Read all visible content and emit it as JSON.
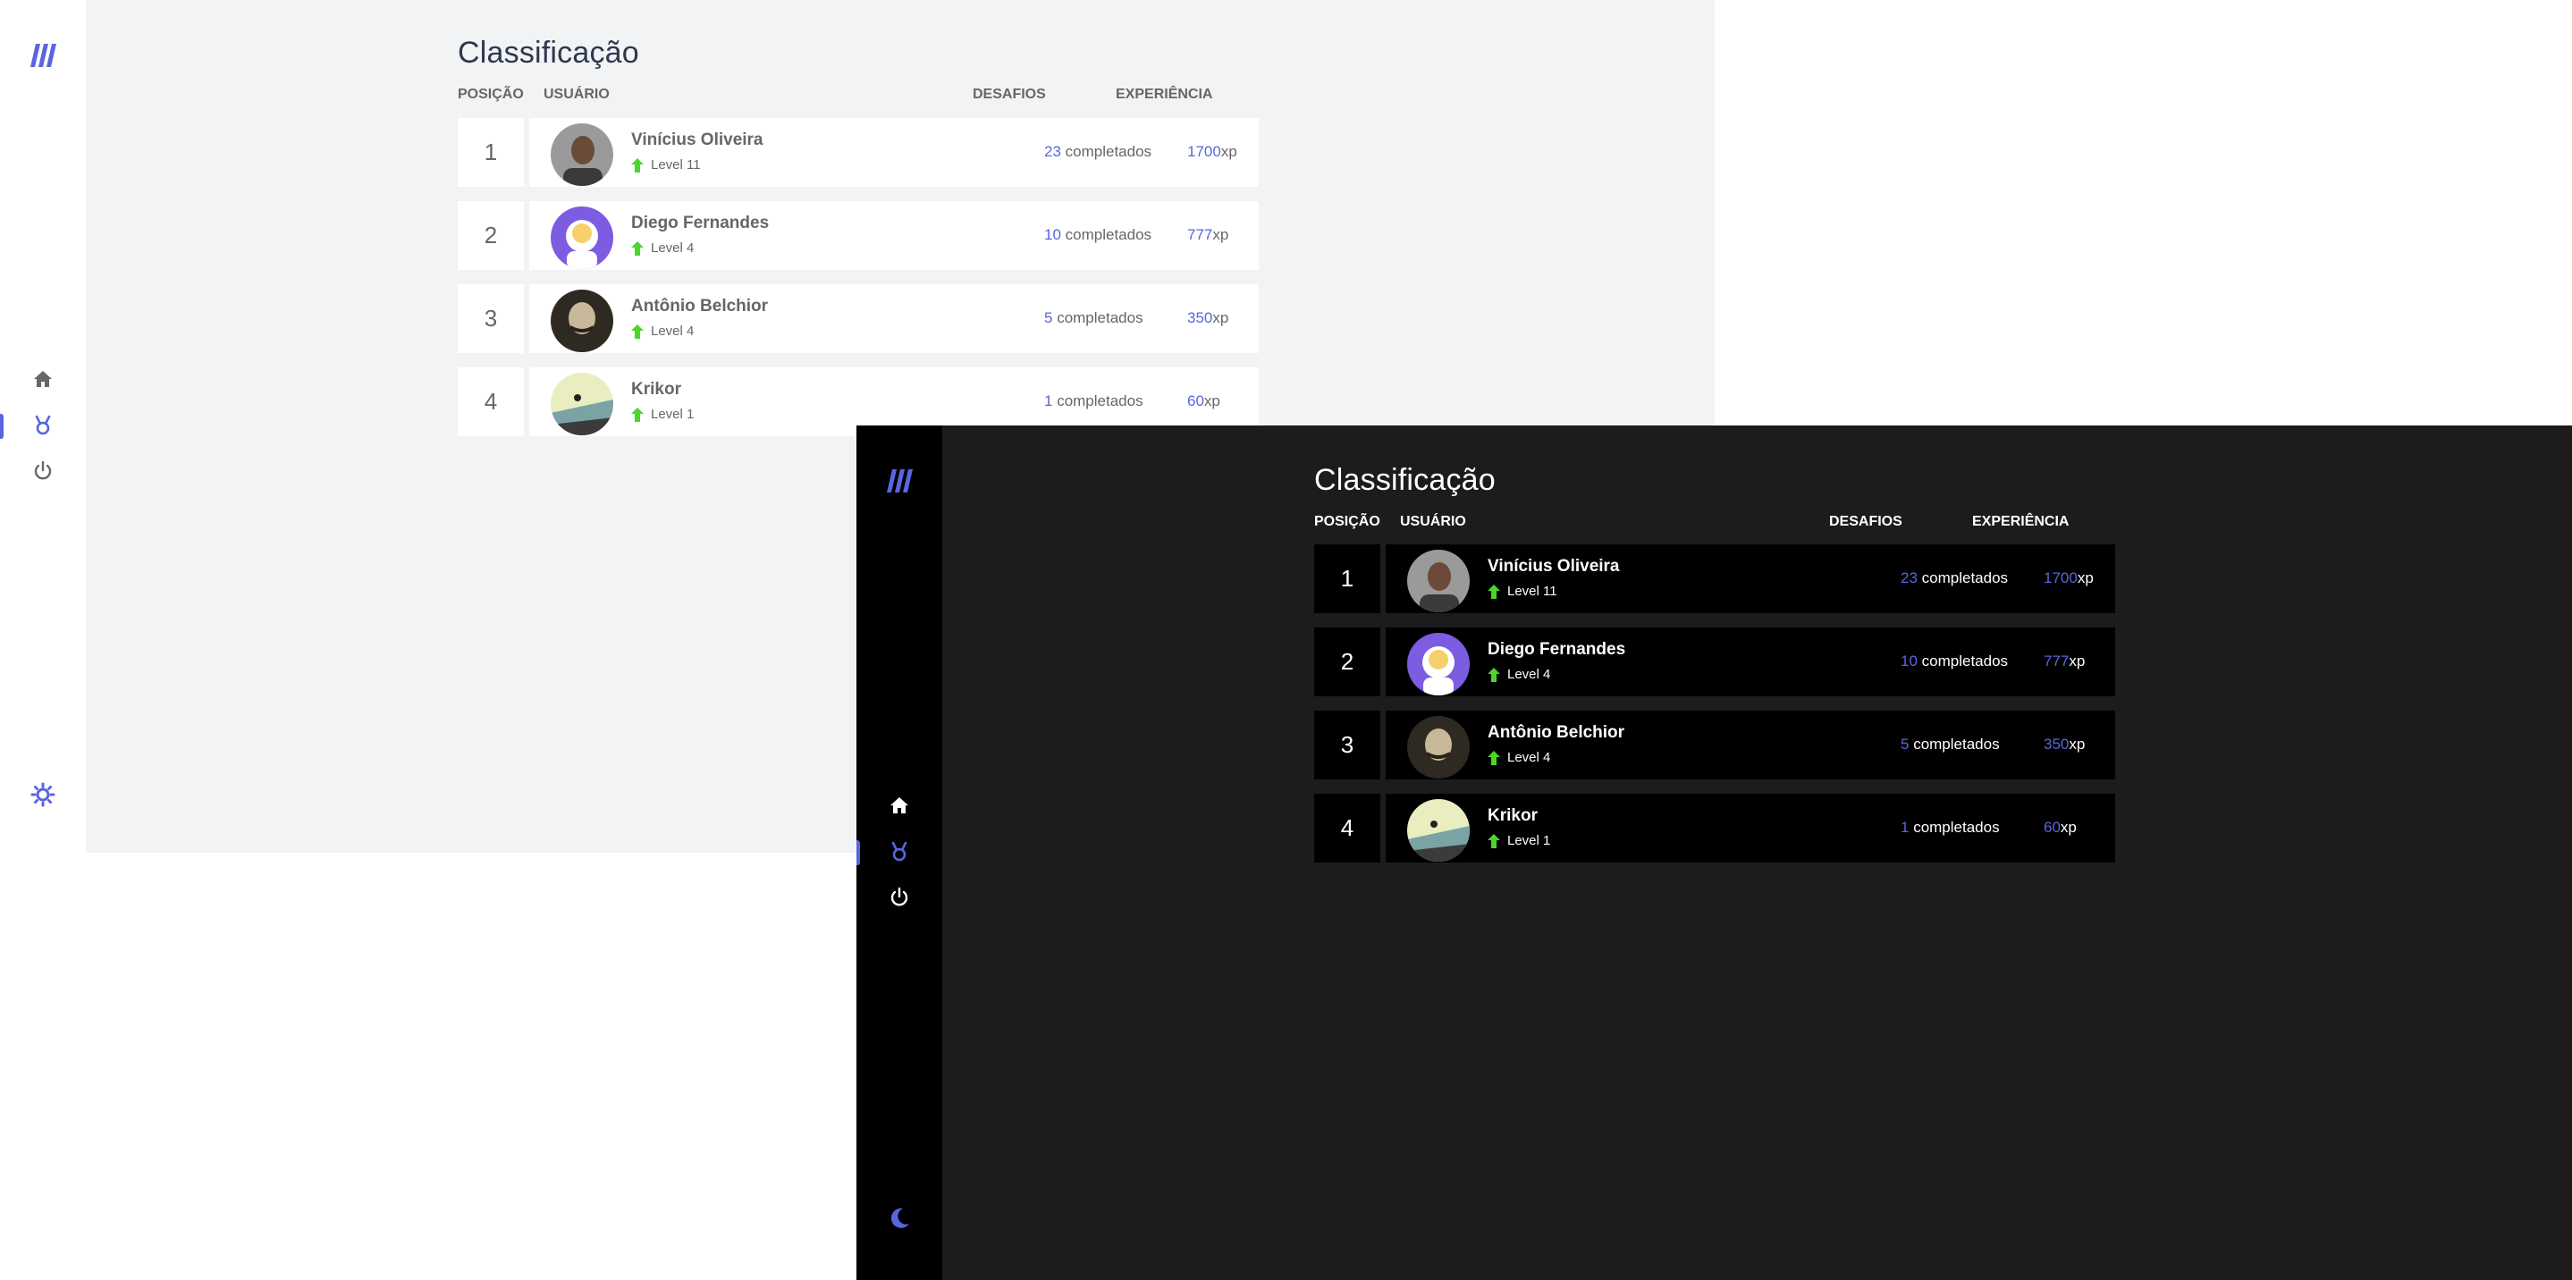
{
  "colors": {
    "accent": "#5965e0",
    "level_up": "#4cd62b"
  },
  "light": {
    "title": "Classificação",
    "columns": {
      "position": "Posição",
      "user": "Usuário",
      "challenges": "Desafios",
      "experience": "Experiência"
    },
    "nav": {
      "home": "home-icon",
      "leaderboard": "medal-icon",
      "logout": "power-icon",
      "theme": "sun-icon"
    },
    "rows": [
      {
        "position": "1",
        "name": "Vinícius Oliveira",
        "level": "Level 11",
        "challenges": "23",
        "challenges_suffix": " completados",
        "xp": "1700",
        "xp_suffix": "xp"
      },
      {
        "position": "2",
        "name": "Diego Fernandes",
        "level": "Level 4",
        "challenges": "10",
        "challenges_suffix": " completados",
        "xp": "777",
        "xp_suffix": "xp"
      },
      {
        "position": "3",
        "name": "Antônio Belchior",
        "level": "Level 4",
        "challenges": "5",
        "challenges_suffix": " completados",
        "xp": "350",
        "xp_suffix": "xp"
      },
      {
        "position": "4",
        "name": "Krikor",
        "level": "Level 1",
        "challenges": "1",
        "challenges_suffix": " completados",
        "xp": "60",
        "xp_suffix": "xp"
      }
    ]
  },
  "dark": {
    "title": "Classificação",
    "columns": {
      "position": "Posição",
      "user": "Usuário",
      "challenges": "Desafios",
      "experience": "Experiência"
    },
    "nav": {
      "home": "home-icon",
      "leaderboard": "medal-icon",
      "logout": "power-icon",
      "theme": "moon-icon"
    },
    "rows": [
      {
        "position": "1",
        "name": "Vinícius Oliveira",
        "level": "Level 11",
        "challenges": "23",
        "challenges_suffix": " completados",
        "xp": "1700",
        "xp_suffix": "xp"
      },
      {
        "position": "2",
        "name": "Diego Fernandes",
        "level": "Level 4",
        "challenges": "10",
        "challenges_suffix": " completados",
        "xp": "777",
        "xp_suffix": "xp"
      },
      {
        "position": "3",
        "name": "Antônio Belchior",
        "level": "Level 4",
        "challenges": "5",
        "challenges_suffix": " completados",
        "xp": "350",
        "xp_suffix": "xp"
      },
      {
        "position": "4",
        "name": "Krikor",
        "level": "Level 1",
        "challenges": "1",
        "challenges_suffix": " completados",
        "xp": "60",
        "xp_suffix": "xp"
      }
    ]
  }
}
